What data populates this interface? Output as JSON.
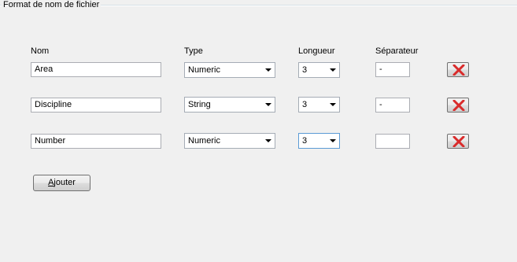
{
  "group": {
    "title": "Format de nom de fichier"
  },
  "headers": {
    "nom": "Nom",
    "type": "Type",
    "longueur": "Longueur",
    "separateur": "Séparateur"
  },
  "rows": [
    {
      "nom": "Area",
      "type": "Numeric",
      "longueur": "3",
      "separateur": "-"
    },
    {
      "nom": "Discipline",
      "type": "String",
      "longueur": "3",
      "separateur": "-"
    },
    {
      "nom": "Number",
      "type": "Numeric",
      "longueur": "3",
      "separateur": ""
    }
  ],
  "icons": {
    "delete": "red-x-delete-icon",
    "dropdown": "chevron-down-icon"
  },
  "colors": {
    "delete_x": "#d92b2b"
  },
  "add_button": {
    "access_key": "A",
    "label_rest": "jouter"
  }
}
